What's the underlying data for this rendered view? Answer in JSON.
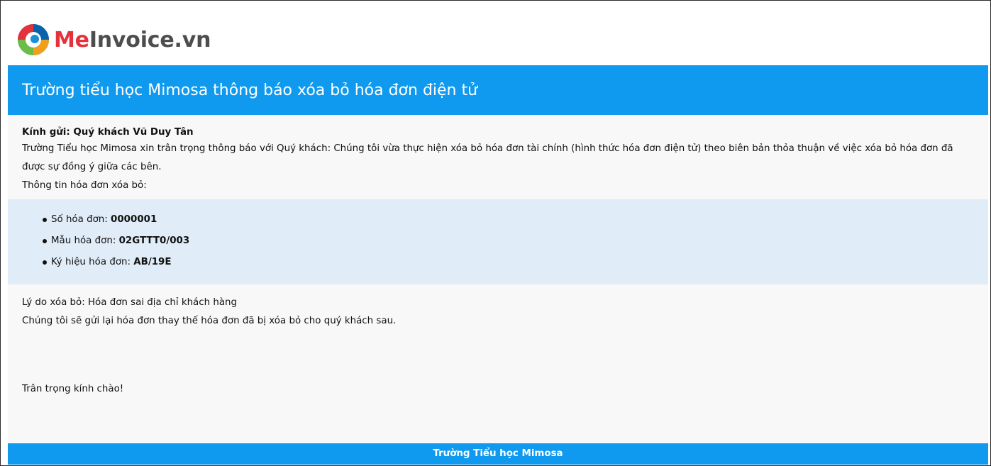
{
  "brand": {
    "logo_prefix": "Me",
    "logo_suffix": "Invoice.vn",
    "logo_icon": "meinvoice-logo-icon",
    "colors": {
      "accent": "#0f9af0",
      "logo_red": "#e5323a",
      "logo_gray": "#4d4d4d",
      "panel": "#f8f8f8",
      "list_bg": "#e0ecf8"
    }
  },
  "header": {
    "title": "Trường tiểu học Mimosa thông báo xóa bỏ hóa đơn điện tử"
  },
  "body": {
    "salutation": "Kính gửi: Quý khách Vũ Duy Tân",
    "intro": "Trường Tiểu học Mimosa xin trân trọng thông báo với Quý khách: Chúng tôi vừa thực hiện xóa bỏ hóa đơn tài chính (hình thức hóa đơn điện tử) theo biên bản thỏa thuận về việc xóa bỏ hóa đơn đã được sự đồng ý giữa các bên.",
    "info_heading": "Thông tin hóa đơn xóa bỏ:",
    "invoice_items": [
      {
        "label": "Số hóa đơn: ",
        "value": "0000001"
      },
      {
        "label": "Mẫu hóa đơn: ",
        "value": "02GTTT0/003"
      },
      {
        "label": "Ký hiệu hóa đơn: ",
        "value": "AB/19E"
      }
    ],
    "reason": "Lý do xóa bỏ: Hóa đơn sai địa chỉ khách hàng",
    "resend_note": "Chúng tôi sẽ gửi lại hóa đơn thay thế hóa đơn đã bị xóa bỏ cho quý khách sau.",
    "signoff": "Trân trọng kính chào!"
  },
  "footer": {
    "sender": "Trường Tiểu học Mimosa"
  }
}
